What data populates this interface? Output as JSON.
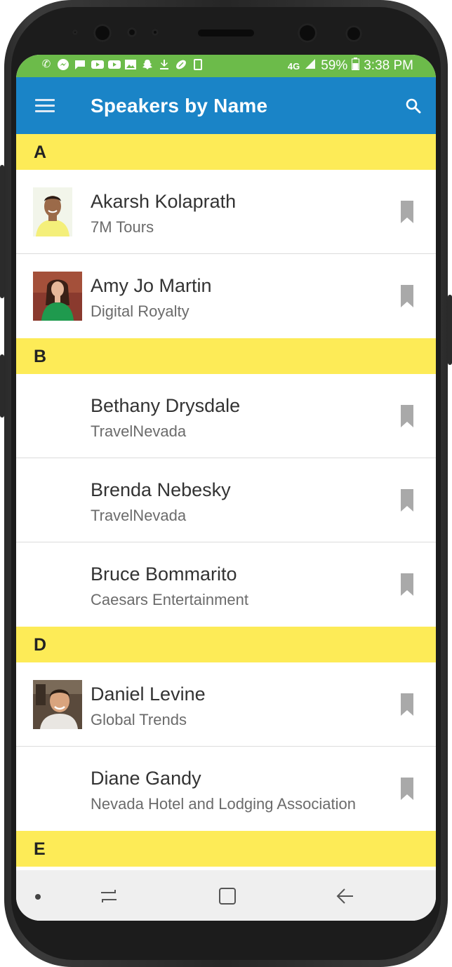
{
  "status_bar": {
    "network": "4G",
    "battery": "59%",
    "time": "3:38 PM"
  },
  "app_bar": {
    "title": "Speakers by Name",
    "menu_icon": "hamburger-menu-icon",
    "search_icon": "search-icon"
  },
  "colors": {
    "status_bar": "#6cbb4a",
    "app_bar": "#1a84c7",
    "section_header": "#fdeb57"
  },
  "sections": [
    {
      "letter": "A",
      "speakers": [
        {
          "name": "Akarsh Kolaprath",
          "company": "7M Tours"
        },
        {
          "name": "Amy Jo Martin",
          "company": "Digital Royalty"
        }
      ]
    },
    {
      "letter": "B",
      "speakers": [
        {
          "name": "Bethany Drysdale",
          "company": "TravelNevada"
        },
        {
          "name": "Brenda Nebesky",
          "company": "TravelNevada"
        },
        {
          "name": "Bruce Bommarito",
          "company": "Caesars Entertainment"
        }
      ]
    },
    {
      "letter": "D",
      "speakers": [
        {
          "name": "Daniel Levine",
          "company": "Global Trends"
        },
        {
          "name": "Diane Gandy",
          "company": "Nevada Hotel and Lodging Association"
        }
      ]
    },
    {
      "letter": "E",
      "speakers": []
    }
  ]
}
